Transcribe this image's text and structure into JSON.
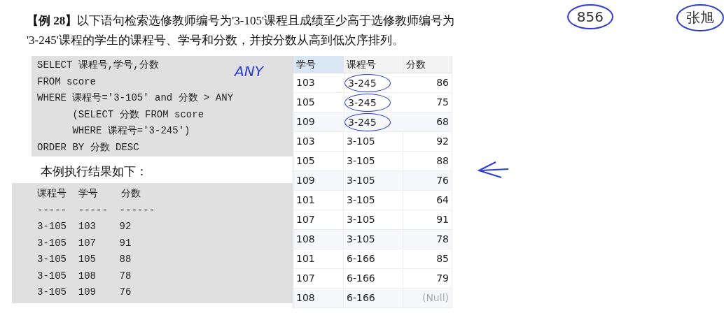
{
  "paragraph": {
    "lines": [
      "**【例 28】**以下语句检索选修教师编号为'3-105'课程且成绩至少高于选修教师编号为",
      "'3-245'课程的学生的课程号、学号和分数，并按分数从高到低次序排列。"
    ]
  },
  "side_values": [
    {
      "text": "856",
      "circled": true
    },
    {
      "text": "张旭",
      "circled": true
    }
  ],
  "sql_code": [
    "SELECT 课程号,学号,分数",
    "FROM score",
    "WHERE 课程号='3-105' and 分数 > ANY",
    "      (SELECT 分数 FROM score",
    "      WHERE 课程号='3-245')",
    "ORDER BY 分数 DESC"
  ],
  "handwriting": "ANY",
  "result_caption": "本例执行结果如下：",
  "result_text": [
    "课程号  学号    分数",
    "-----  -----  ------",
    "3-105  103    92",
    "3-105  107    91",
    "3-105  105    88",
    "3-105  108    78",
    "3-105  109    76"
  ],
  "table": {
    "columns": [
      {
        "label": "学号",
        "selected": true
      },
      {
        "label": "课程号",
        "selected": false
      },
      {
        "label": "分数",
        "selected": false
      }
    ],
    "rows": [
      {
        "cells": [
          "103",
          "3-245",
          "86"
        ],
        "circled": true,
        "null_score": false
      },
      {
        "cells": [
          "105",
          "3-245",
          "75"
        ],
        "circled": true,
        "null_score": false
      },
      {
        "cells": [
          "109",
          "3-245",
          "68"
        ],
        "circled": true,
        "null_score": false
      },
      {
        "cells": [
          "103",
          "3-105",
          "92"
        ],
        "circled": false,
        "null_score": false
      },
      {
        "cells": [
          "105",
          "3-105",
          "88"
        ],
        "circled": false,
        "null_score": false
      },
      {
        "cells": [
          "109",
          "3-105",
          "76"
        ],
        "circled": false,
        "null_score": false
      },
      {
        "cells": [
          "101",
          "3-105",
          "64"
        ],
        "circled": false,
        "null_score": false
      },
      {
        "cells": [
          "107",
          "3-105",
          "91"
        ],
        "circled": false,
        "null_score": false
      },
      {
        "cells": [
          "108",
          "3-105",
          "78"
        ],
        "circled": false,
        "null_score": false
      },
      {
        "cells": [
          "101",
          "6-166",
          "85"
        ],
        "circled": false,
        "null_score": false
      },
      {
        "cells": [
          "107",
          "6-166",
          "79"
        ],
        "circled": false,
        "null_score": false
      },
      {
        "cells": [
          "108",
          "6-166",
          "(Null)"
        ],
        "circled": false,
        "null_score": true
      }
    ]
  }
}
